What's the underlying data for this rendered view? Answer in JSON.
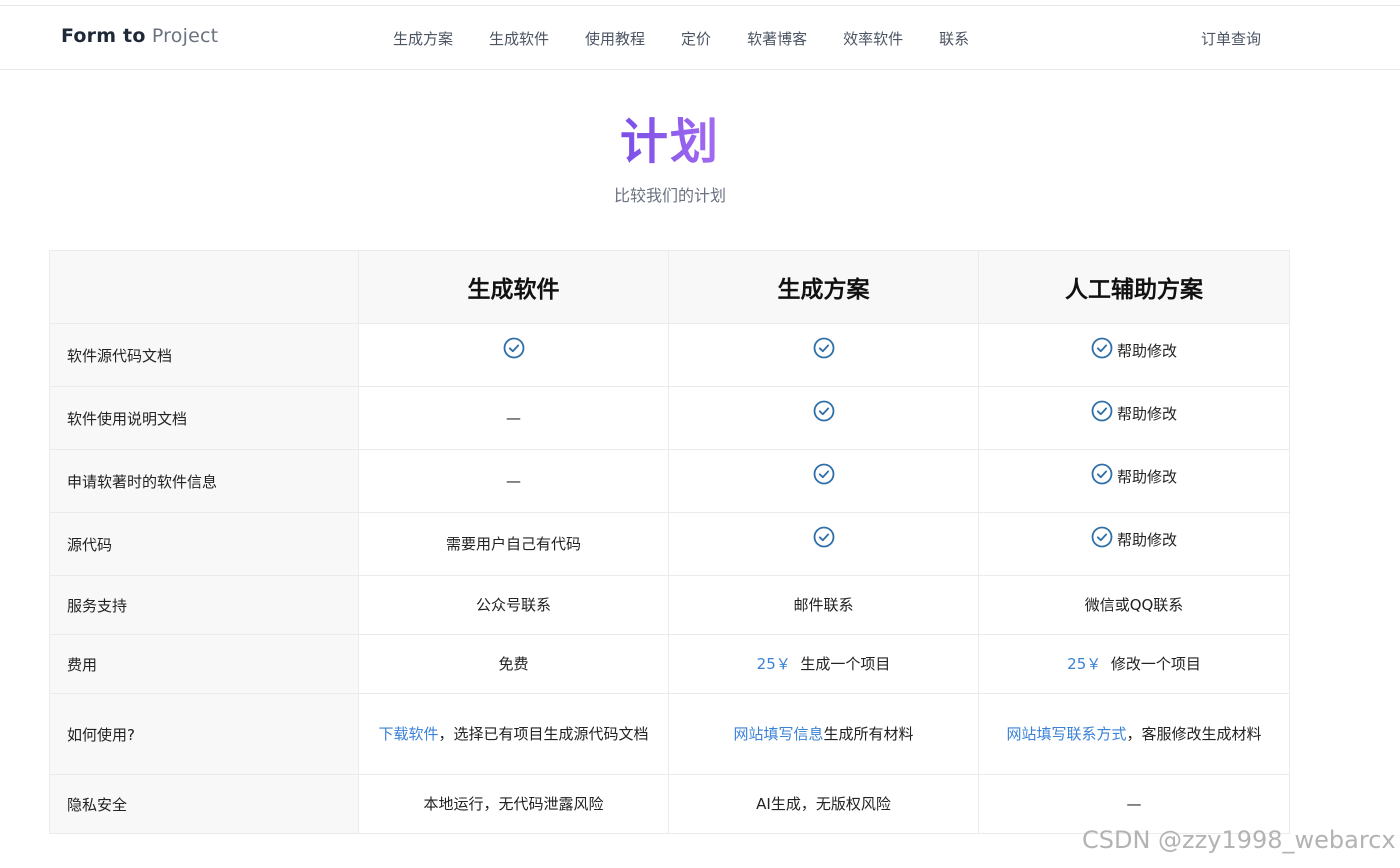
{
  "nav": {
    "brand_bold": "Form to",
    "brand_light": "Project",
    "items": [
      "生成方案",
      "生成软件",
      "使用教程",
      "定价",
      "软著博客",
      "效率软件",
      "联系"
    ],
    "order_query": "订单查询"
  },
  "hero": {
    "title": "计划",
    "subtitle": "比较我们的计划"
  },
  "table": {
    "headers": [
      "生成软件",
      "生成方案",
      "人工辅助方案"
    ],
    "rows": [
      {
        "label": "软件源代码文档",
        "c1": "",
        "c2": "",
        "c3": "帮助修改"
      },
      {
        "label": "软件使用说明文档",
        "c1": "—",
        "c2": "",
        "c3": "帮助修改"
      },
      {
        "label": "申请软著时的软件信息",
        "c1": "—",
        "c2": "",
        "c3": "帮助修改"
      },
      {
        "label": "源代码",
        "c1": "需要用户自己有代码",
        "c2": "",
        "c3": "帮助修改"
      },
      {
        "label": "服务支持",
        "c1": "公众号联系",
        "c2": "邮件联系",
        "c3": "微信或QQ联系"
      },
      {
        "label": "费用",
        "c1": "免费",
        "c2_price": "25￥",
        "c2_text": "生成一个项目",
        "c3_price": "25￥",
        "c3_text": "修改一个项目"
      },
      {
        "label": "如何使用?",
        "c1_link": "下载软件",
        "c1_text": "，选择已有项目生成源代码文档",
        "c2_link": "网站填写信息",
        "c2_text": "生成所有材料",
        "c3_link": "网站填写联系方式",
        "c3_text": "，客服修改生成材料"
      },
      {
        "label": "隐私安全",
        "c1": "本地运行，无代码泄露风险",
        "c2": "AI生成，无版权风险",
        "c3": "—"
      }
    ]
  },
  "watermark": "CSDN @zzy1998_webarcx",
  "colors": {
    "accent_link": "#3b82d6",
    "check_icon": "#2f6fa8",
    "title_gradient_start": "#7a4ee8",
    "title_gradient_end": "#a36cf0"
  }
}
